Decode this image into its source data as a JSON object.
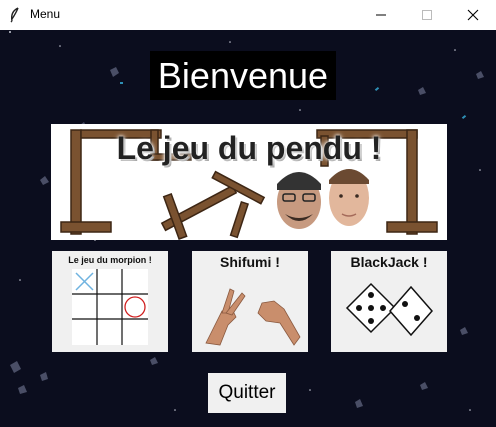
{
  "window": {
    "title": "Menu",
    "icon": "feather-icon",
    "controls": [
      "minimize-icon",
      "maximize-icon",
      "close-icon"
    ]
  },
  "main": {
    "welcome": "Bienvenue",
    "games": {
      "pendu": "Le jeu du pendu !",
      "morpion": "Le jeu du morpion !",
      "shifumi": "Shifumi !",
      "blackjack": "BlackJack !"
    },
    "quit_label": "Quitter"
  },
  "colors": {
    "background": "#0b0d1e",
    "card": "#f0f0f0",
    "wood": "#7a5230",
    "morpion_x": "#6fb3e0",
    "morpion_o": "#d02020"
  }
}
